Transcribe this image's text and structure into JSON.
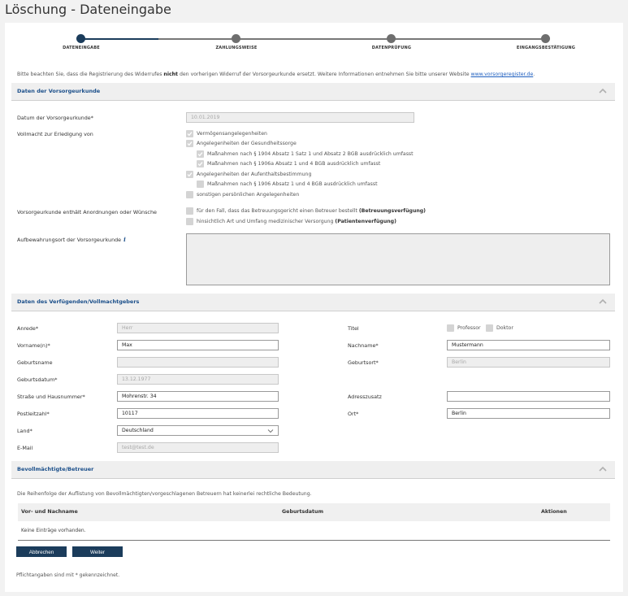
{
  "page_title": "Löschung - Dateneingabe",
  "steps": [
    {
      "label": "DATENEINGABE",
      "active": true
    },
    {
      "label": "ZAHLUNGSWEISE",
      "active": false
    },
    {
      "label": "DATENPRÜFUNG",
      "active": false
    },
    {
      "label": "EINGANGSBESTÄTIGUNG",
      "active": false
    }
  ],
  "intro": {
    "before": "Bitte beachten Sie, dass die Registrierung des Widerrufes ",
    "bold": "nicht",
    "after": " den vorherigen Widerruf der Vorsorgeurkunde ersetzt. Weitere Informationen entnehmen Sie bitte unserer Website ",
    "link": "www.vorsorgeregister.de",
    "end": "."
  },
  "section1": {
    "title": "Daten der Vorsorgeurkunde",
    "date_label": "Datum der Vorsorgeurkunde*",
    "date_value": "10.01.2019",
    "vollmacht_label": "Vollmacht zur Erledigung von",
    "vollmacht_options": [
      {
        "label": "Vermögensangelegenheiten",
        "checked": true
      },
      {
        "label": "Angelegenheiten der Gesundheitssorge",
        "checked": true
      },
      {
        "label": "Maßnahmen nach § 1904 Absatz 1 Satz 1 und Absatz 2 BGB ausdrücklich umfasst",
        "checked": true
      },
      {
        "label": "Maßnahmen nach § 1906a Absatz 1 und 4 BGB ausdrücklich umfasst",
        "checked": true
      },
      {
        "label": "Angelegenheiten der Aufenthaltsbestimmung",
        "checked": true
      },
      {
        "label": "Maßnahmen nach § 1906 Absatz 1 und 4 BGB ausdrücklich umfasst",
        "checked": false
      },
      {
        "label": "sonstigen persönlichen Angelegenheiten",
        "checked": false
      }
    ],
    "anordnungen_label": "Vorsorgeurkunde enthält Anordnungen oder Wünsche",
    "anordnungen_options": [
      {
        "label": "für den Fall, dass das Betreuungsgericht einen Betreuer bestellt ",
        "bold": "(Betreuungsverfügung)",
        "checked": false
      },
      {
        "label": "hinsichtlich Art und Umfang medizinischer Versorgung ",
        "bold": "(Patientenverfügung)",
        "checked": false
      }
    ],
    "aufbewahrung_label": "Aufbewahrungsort der Vorsorgeurkunde",
    "info_icon": "i"
  },
  "section2": {
    "title": "Daten des Verfügenden/Vollmachtgebers",
    "anrede_label": "Anrede*",
    "anrede_value": "Herr",
    "titel_label": "Titel",
    "titel_professor": "Professor",
    "titel_doktor": "Doktor",
    "vorname_label": "Vorname(n)*",
    "vorname_value": "Max",
    "nachname_label": "Nachname*",
    "nachname_value": "Mustermann",
    "geburtsname_label": "Geburtsname",
    "geburtsname_value": "",
    "geburtsort_label": "Geburtsort*",
    "geburtsort_value": "Berlin",
    "geburtsdatum_label": "Geburtsdatum*",
    "geburtsdatum_value": "13.12.1977",
    "strasse_label": "Straße und Hausnummer*",
    "strasse_value": "Mohrenstr. 34",
    "adresszusatz_label": "Adresszusatz",
    "adresszusatz_value": "",
    "plz_label": "Postleitzahl*",
    "plz_value": "10117",
    "ort_label": "Ort*",
    "ort_value": "Berlin",
    "land_label": "Land*",
    "land_value": "Deutschland",
    "email_label": "E-Mail",
    "email_value": "test@test.de"
  },
  "section3": {
    "title": "Bevollmächtigte/Betreuer",
    "note": "Die Reihenfolge der Auflistung von Bevollmächtigten/vorgeschlagenen Betreuern hat keinerlei rechtliche Bedeutung.",
    "columns": [
      "Vor- und Nachname",
      "Geburtsdatum",
      "Aktionen"
    ],
    "empty": "Keine Einträge vorhanden."
  },
  "buttons": {
    "cancel": "Abbrechen",
    "next": "Weiter"
  },
  "footnote": "Pflichtangaben sind mit * gekennzeichnet.",
  "colors": {
    "primary": "#1b3c5b",
    "link": "#1b4f8a"
  }
}
